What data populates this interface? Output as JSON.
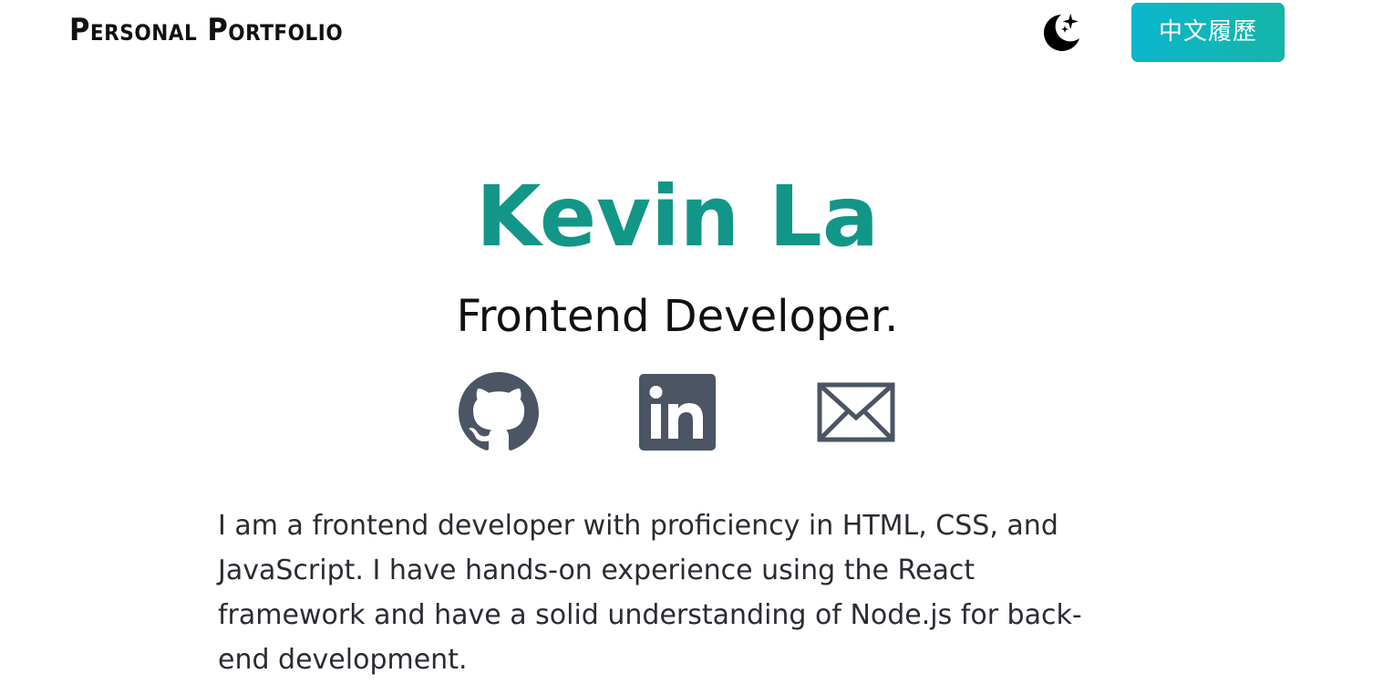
{
  "header": {
    "brand": "Personal Portfolio",
    "theme_toggle_icon": "moon-stars-icon",
    "lang_button_label": "中文履歷"
  },
  "hero": {
    "name": "Kevin La",
    "role": "Frontend Developer.",
    "name_color": "#129688"
  },
  "social": [
    {
      "icon": "github-icon"
    },
    {
      "icon": "linkedin-icon"
    },
    {
      "icon": "mail-icon"
    }
  ],
  "about": {
    "text": "I am a frontend developer with proficiency in HTML, CSS, and JavaScript. I have hands-on experience using the React framework and have a solid understanding of Node.js for back-end development."
  },
  "colors": {
    "accent": "#129688",
    "button_start": "#0ab6cd",
    "button_end": "#14b5a8",
    "icon": "#4b5563"
  }
}
